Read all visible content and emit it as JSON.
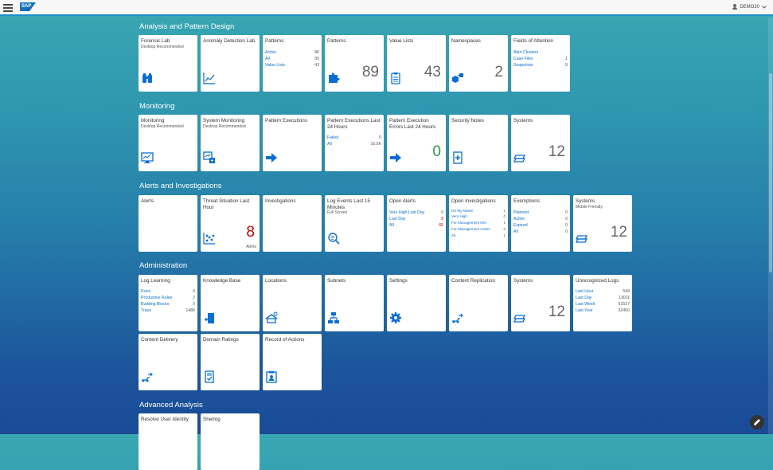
{
  "shell": {
    "logo_text": "SAP",
    "username": "DEMO20"
  },
  "groups": {
    "analysis": {
      "title": "Analysis and Pattern Design",
      "tiles": {
        "forensic_lab": {
          "title": "Forensic Lab",
          "subtitle": "Desktop Recommended",
          "icon": "binoculars-icon"
        },
        "anomaly": {
          "title": "Anomaly Detection Lab",
          "icon": "line-chart-icon"
        },
        "patterns_list": {
          "title": "Patterns",
          "rows": [
            {
              "label": "Active",
              "value": "86"
            },
            {
              "label": "All",
              "value": "89"
            },
            {
              "label": "Value Lists",
              "value": "43"
            }
          ]
        },
        "patterns": {
          "title": "Patterns",
          "number": "89",
          "icon": "puzzle-icon"
        },
        "value_lists": {
          "title": "Value Lists",
          "number": "43",
          "icon": "clipboard-icon"
        },
        "namespaces": {
          "title": "Namespaces",
          "number": "2",
          "icon": "namespaces-icon"
        },
        "fields_attention": {
          "title": "Fields of Attention",
          "rows": [
            {
              "label": "Alert Clusters",
              "value": ""
            },
            {
              "label": "Case Files",
              "value": "1"
            },
            {
              "label": "Snapshots",
              "value": "8"
            }
          ]
        }
      }
    },
    "monitoring": {
      "title": "Monitoring",
      "tiles": {
        "monitoring": {
          "title": "Monitoring",
          "subtitle": "Desktop Recommended",
          "icon": "monitor-icon"
        },
        "system_monitoring": {
          "title": "System Monitoring",
          "subtitle": "Desktop Recommended",
          "icon": "system-monitor-icon"
        },
        "pattern_executions": {
          "title": "Pattern Executions",
          "icon": "arrow-right-icon"
        },
        "pattern_exec_24": {
          "title": "Pattern Executions Last 24 Hours",
          "rows": [
            {
              "label": "Failed",
              "value": "0"
            },
            {
              "label": "All",
              "value": "16.5K"
            }
          ]
        },
        "pattern_exec_errors": {
          "title": "Pattern Execution Errors Last 24 Hours",
          "number": "0",
          "icon": "arrow-right-icon"
        },
        "security_notes": {
          "title": "Security Notes",
          "icon": "notes-icon"
        },
        "systems": {
          "title": "Systems",
          "number": "12",
          "icon": "systems-icon"
        }
      }
    },
    "alerts": {
      "title": "Alerts and Investigations",
      "tiles": {
        "alerts": {
          "title": "Alerts"
        },
        "threat": {
          "title": "Threat Situation Last Hour",
          "number": "8",
          "unit": "Alerts",
          "icon": "scatter-icon"
        },
        "investigations": {
          "title": "Investigations"
        },
        "log_events": {
          "title": "Log Events Last 15 Minutes",
          "subtitle": "Full Screen",
          "icon": "search-log-icon"
        },
        "open_alerts": {
          "title": "Open Alerts",
          "rows": [
            {
              "label": "Very High Last Day",
              "value": "0"
            },
            {
              "label": "Last Day",
              "value": "9"
            },
            {
              "label": "All",
              "value": "65"
            }
          ]
        },
        "open_investigations": {
          "title": "Open Investigations",
          "rows": [
            {
              "label": "On My Name",
              "value": "1"
            },
            {
              "label": "Very High",
              "value": "0"
            },
            {
              "label": "For Management Info",
              "value": "1"
            },
            {
              "label": "For Management Action",
              "value": "0"
            },
            {
              "label": "All",
              "value": "1"
            }
          ]
        },
        "exemptions": {
          "title": "Exemptions",
          "rows": [
            {
              "label": "Planned",
              "value": "0"
            },
            {
              "label": "Active",
              "value": "0"
            },
            {
              "label": "Expired",
              "value": "0"
            },
            {
              "label": "All",
              "value": "0"
            }
          ]
        },
        "systems_mobile": {
          "title": "Systems",
          "subtitle": "Mobile Friendly",
          "number": "12",
          "icon": "systems-icon"
        }
      }
    },
    "administration": {
      "title": "Administration",
      "tiles": {
        "log_learning": {
          "title": "Log Learning",
          "rows": [
            {
              "label": "Runs",
              "value": "0"
            },
            {
              "label": "Productive Rules",
              "value": "2"
            },
            {
              "label": "Building Blocks",
              "value": "0"
            },
            {
              "label": "Trace",
              "value": "1486"
            }
          ]
        },
        "knowledge_base": {
          "title": "Knowledge Base",
          "icon": "book-add-icon"
        },
        "locations": {
          "title": "Locations",
          "icon": "locations-icon"
        },
        "subnets": {
          "title": "Subnets",
          "icon": "network-icon"
        },
        "settings": {
          "title": "Settings",
          "icon": "gear-icon"
        },
        "content_replication": {
          "title": "Content Replication",
          "icon": "replication-icon"
        },
        "systems": {
          "title": "Systems",
          "number": "12",
          "icon": "systems-icon"
        },
        "unrecognized_logs": {
          "title": "Unrecognized Logs",
          "rows": [
            {
              "label": "Last Hour",
              "value": "549"
            },
            {
              "label": "Last Day",
              "value": "13011"
            },
            {
              "label": "Last Week",
              "value": "51517"
            },
            {
              "label": "Last Year",
              "value": "52450"
            }
          ]
        },
        "content_delivery": {
          "title": "Content Delivery",
          "icon": "delivery-icon"
        },
        "domain_ratings": {
          "title": "Domain Ratings",
          "icon": "document-check-icon"
        },
        "record_actions": {
          "title": "Record of Actions",
          "icon": "record-icon"
        }
      }
    },
    "advanced": {
      "title": "Advanced Analysis",
      "tiles": {
        "resolve_user": {
          "title": "Resolve User Identity"
        },
        "sherlog": {
          "title": "Sherlog"
        }
      }
    }
  },
  "colors": {
    "accent": "#0a6ed1",
    "icon": "#0a6ed1",
    "shell_border": "#1e90c8"
  }
}
